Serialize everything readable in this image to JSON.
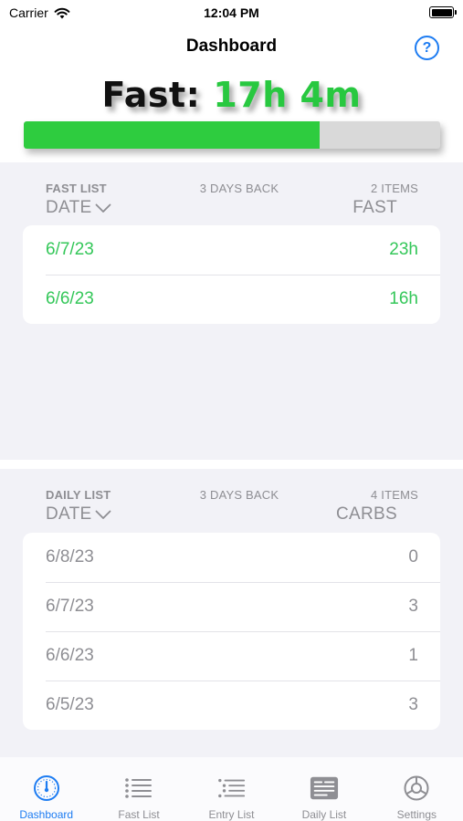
{
  "status": {
    "carrier": "Carrier",
    "time": "12:04 PM"
  },
  "nav": {
    "title": "Dashboard",
    "help_label": "?"
  },
  "fast": {
    "label": "Fast:",
    "value": "17h 4m",
    "progress": 0.71
  },
  "fast_list": {
    "title": "FAST LIST",
    "range": "3 DAYS BACK",
    "count": "2 ITEMS",
    "col_date": "DATE",
    "col_value": "FAST",
    "rows": [
      {
        "date": "6/7/23",
        "value": "23h"
      },
      {
        "date": "6/6/23",
        "value": "16h"
      }
    ]
  },
  "daily_list": {
    "title": "DAILY LIST",
    "range": "3 DAYS BACK",
    "count": "4 ITEMS",
    "col_date": "DATE",
    "col_value": "CARBS",
    "rows": [
      {
        "date": "6/8/23",
        "value": "0"
      },
      {
        "date": "6/7/23",
        "value": "3"
      },
      {
        "date": "6/6/23",
        "value": "1"
      },
      {
        "date": "6/5/23",
        "value": "3"
      }
    ]
  },
  "tabs": [
    {
      "label": "Dashboard",
      "icon": "gauge-icon",
      "active": true
    },
    {
      "label": "Fast List",
      "icon": "list-icon",
      "active": false
    },
    {
      "label": "Entry List",
      "icon": "indented-list-icon",
      "active": false
    },
    {
      "label": "Daily List",
      "icon": "doc-text-icon",
      "active": false
    },
    {
      "label": "Settings",
      "icon": "gear-icon",
      "active": false
    }
  ],
  "colors": {
    "accent": "#1d7cf2",
    "green": "#34c759",
    "gray": "#8e8e93"
  }
}
